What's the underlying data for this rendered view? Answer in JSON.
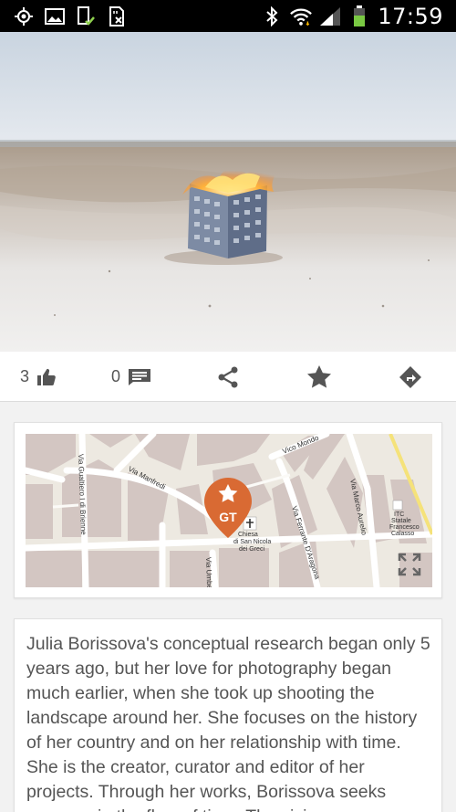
{
  "status_bar": {
    "time": "17:59",
    "left_icons": [
      "gps-icon",
      "gallery-icon",
      "phone-check-icon",
      "sd-card-icon"
    ],
    "right_icons": [
      "bluetooth-icon",
      "wifi-icon",
      "signal-icon",
      "battery-icon"
    ]
  },
  "photo": {
    "subject": "burning-building-cube-photo"
  },
  "actions": {
    "likes_count": "3",
    "comments_count": "0"
  },
  "map": {
    "marker_label": "GT",
    "streets": [
      "Via Gualtiero I di Brienne",
      "Via Manfredi",
      "Vico Mondo",
      "Via Ferrante D'Aragona",
      "Via Marco Aurelio",
      "Via Umberto"
    ],
    "poi": [
      "Chiesa",
      "di San Nicola",
      "dei Greci",
      "ITC",
      "Statale",
      "Francesco",
      "Calasso"
    ]
  },
  "description": {
    "text": "Julia Borissova's conceptual research began only 5 years ago, but her love for photography began much earlier, when she took up shooting the landscape around her. She focuses on the history of her country and on her relationship with time. She is the creator, curator and editor of her projects. Through her works, Borissova seeks answers in the flow of time. The vision"
  },
  "colors": {
    "accent_marker": "#d96a33",
    "icon_gray": "#555555",
    "map_background": "#e9e5dc",
    "building": "#d3c6c2"
  }
}
